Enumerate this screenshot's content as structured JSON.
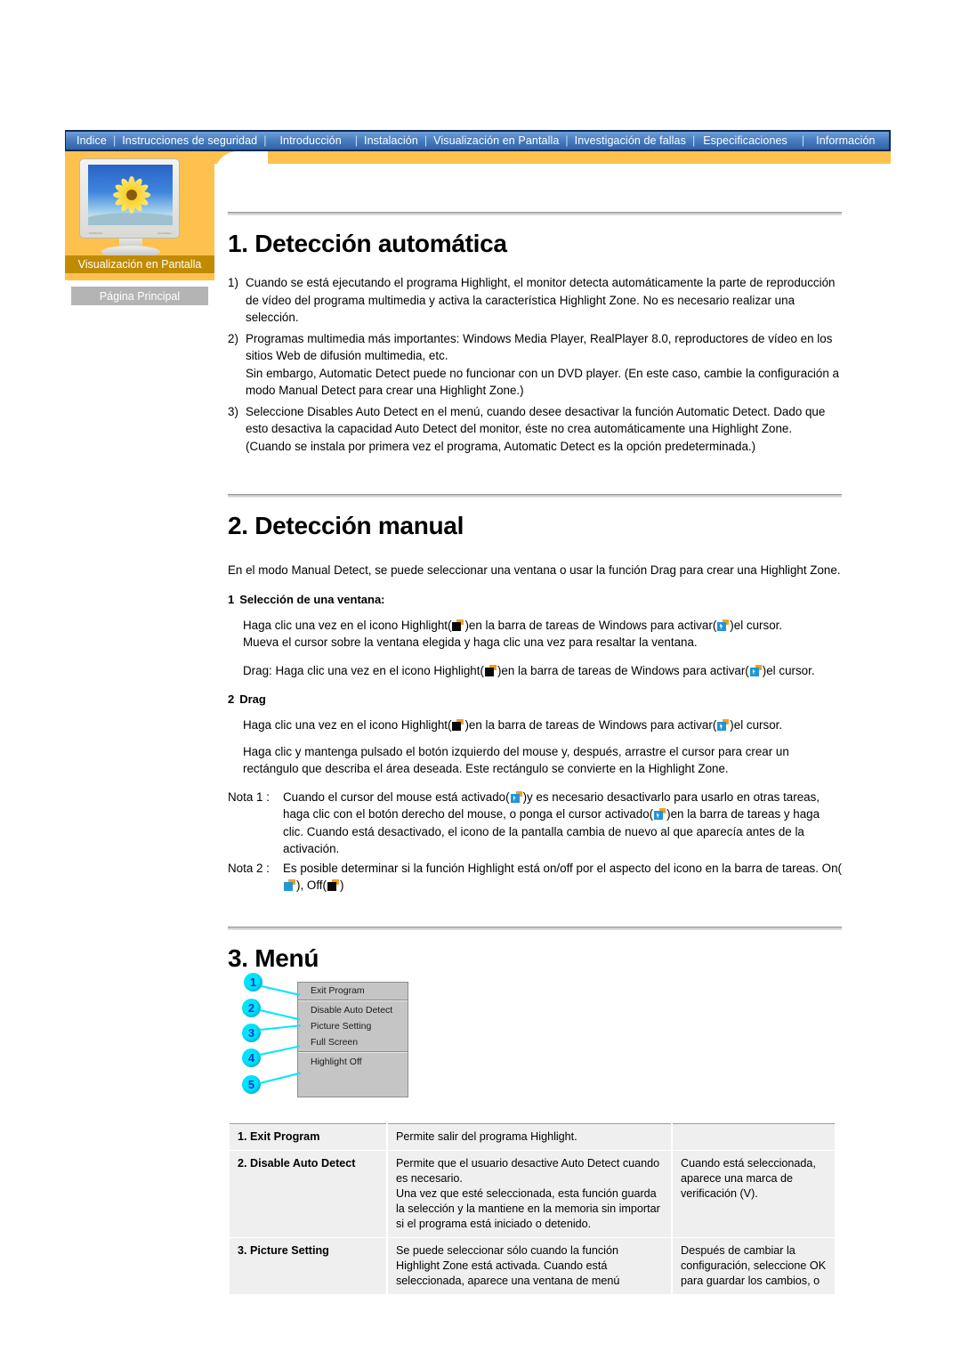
{
  "nav": {
    "items": [
      {
        "label": "Indice"
      },
      {
        "label": "Instrucciones de seguridad"
      },
      {
        "label": "Introducción"
      },
      {
        "label": "Instalación"
      },
      {
        "label": "Visualización en Pantalla"
      },
      {
        "label": "Investigación de fallas"
      },
      {
        "label": "Especificaciones"
      },
      {
        "label": "Información"
      }
    ],
    "separator": "|"
  },
  "sidebar": {
    "caption": "Visualización en Pantalla",
    "home_button": "Página Principal",
    "monitor_brand": "SAMSUNG",
    "monitor_model": "SyncMaster"
  },
  "section1": {
    "title": "1. Detección automática",
    "items": [
      {
        "num": "1)",
        "text": "Cuando se está ejecutando el programa Highlight, el monitor detecta automáticamente la parte de reproducción de vídeo del programa multimedia y activa la característica Highlight Zone. No es necesario realizar una selección."
      },
      {
        "num": "2)",
        "text": "Programas multimedia más importantes: Windows Media Player, RealPlayer 8.0, reproductores de vídeo en los sitios Web de difusión multimedia, etc.",
        "extra": "Sin embargo, Automatic Detect puede no funcionar con un DVD player. (En este caso, cambie la configuración a modo Manual Detect para crear una Highlight Zone.)"
      },
      {
        "num": "3)",
        "text": "Seleccione Disables Auto Detect en el menú, cuando desee desactivar la función Automatic Detect. Dado que esto desactiva la capacidad Auto Detect del monitor, éste no crea automáticamente una Highlight Zone.",
        "extra": "(Cuando se instala por primera vez el programa, Automatic Detect es la opción predeterminada.)"
      }
    ]
  },
  "section2": {
    "title": "2. Detección manual",
    "intro": "En el modo Manual Detect, se puede seleccionar una ventana o usar la función Drag para crear una Highlight Zone.",
    "sub1": {
      "num": "1",
      "label": "Selección de una ventana:",
      "p1_a": "Haga clic una vez en el icono Highlight(",
      "p1_b": ")en la barra de tareas de Windows para activar(",
      "p1_c": ")el cursor.",
      "p1_d": "Mueva el cursor sobre la ventana elegida y haga clic una vez para resaltar la ventana.",
      "p2_a": "Drag: Haga clic una vez en el icono Highlight(",
      "p2_b": ")en la barra de tareas de Windows para activar(",
      "p2_c": ")el cursor."
    },
    "sub2": {
      "num": "2",
      "label": "Drag",
      "p1_a": "Haga clic una vez en el icono Highlight(",
      "p1_b": ")en la barra de tareas de Windows para activar(",
      "p1_c": ")el cursor.",
      "p2": "Haga clic y mantenga pulsado el botón izquierdo del mouse y, después, arrastre el cursor para crear un rectángulo que describa el área deseada. Este rectángulo se convierte en la Highlight Zone."
    },
    "note1": {
      "label": "Nota 1 :",
      "a": "Cuando el cursor del mouse está activado(",
      "b": ")y es necesario desactivarlo para usarlo en otras tareas, haga clic con el botón derecho del mouse, o ponga el cursor activado(",
      "c": ")en la barra de tareas y haga clic. Cuando está desactivado, el icono de la pantalla cambia de nuevo al que aparecía antes de la activación."
    },
    "note2": {
      "label": "Nota 2 :",
      "a": "Es posible determinar si la función Highlight está on/off por el aspecto del icono en la barra de tareas. On(",
      "b": "), Off(",
      "c": ")"
    }
  },
  "section3": {
    "title": "3. Menú",
    "menu": {
      "items": [
        {
          "callout": "1",
          "label": "Exit Program"
        },
        {
          "callout": "2",
          "label": "Disable Auto Detect"
        },
        {
          "callout": "3",
          "label": "Picture Setting"
        },
        {
          "callout": "4",
          "label": "Full Screen"
        },
        {
          "callout": "5",
          "label": "Highlight Off"
        }
      ]
    },
    "table": {
      "rows": [
        {
          "name": "1. Exit Program",
          "desc": "Permite salir del programa Highlight.",
          "note": ""
        },
        {
          "name": "2. Disable Auto Detect",
          "desc": "Permite que el usuario desactive Auto Detect cuando es necesario.\nUna vez que esté seleccionada, esta función guarda la selección y la mantiene en la memoria sin importar si el programa está iniciado o detenido.",
          "note": "Cuando está seleccionada, aparece una marca de verificación (V)."
        },
        {
          "name": "3. Picture Setting",
          "desc": "Se puede seleccionar sólo cuando la función Highlight Zone está activada. Cuando está seleccionada, aparece una ventana de menú",
          "note": "Después de cambiar la configuración, seleccione OK para guardar los cambios, o"
        }
      ]
    }
  },
  "colors": {
    "nav_blue": "#4a7fc1",
    "sidebar_orange": "#ffc14d",
    "caption_brown": "#c18b00",
    "callout_cyan": "#00e5ff",
    "table_bg": "#efefef"
  }
}
